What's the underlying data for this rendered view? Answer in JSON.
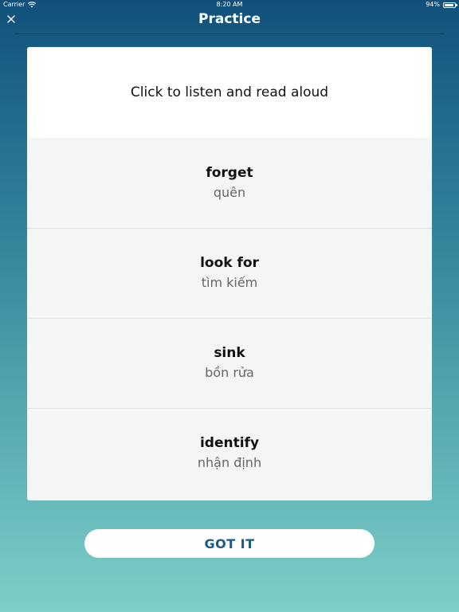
{
  "status_bar": {
    "carrier": "Carrier",
    "time": "8:20 AM",
    "battery": "94%",
    "battery_level": 0.94
  },
  "nav": {
    "title": "Practice",
    "close_icon": "close-icon"
  },
  "card": {
    "instruction": "Click to listen and read aloud",
    "words": [
      {
        "term": "forget",
        "meaning": "quên"
      },
      {
        "term": "look for",
        "meaning": "tìm kiếm"
      },
      {
        "term": "sink",
        "meaning": "bồn rửa"
      },
      {
        "term": "identify",
        "meaning": "nhận định"
      }
    ]
  },
  "button": {
    "label": "GOT IT"
  },
  "colors": {
    "background_top": "#11507a",
    "background_bottom": "#7ccfc6",
    "button_text": "#1a5a82",
    "meaning_text": "#666666"
  }
}
